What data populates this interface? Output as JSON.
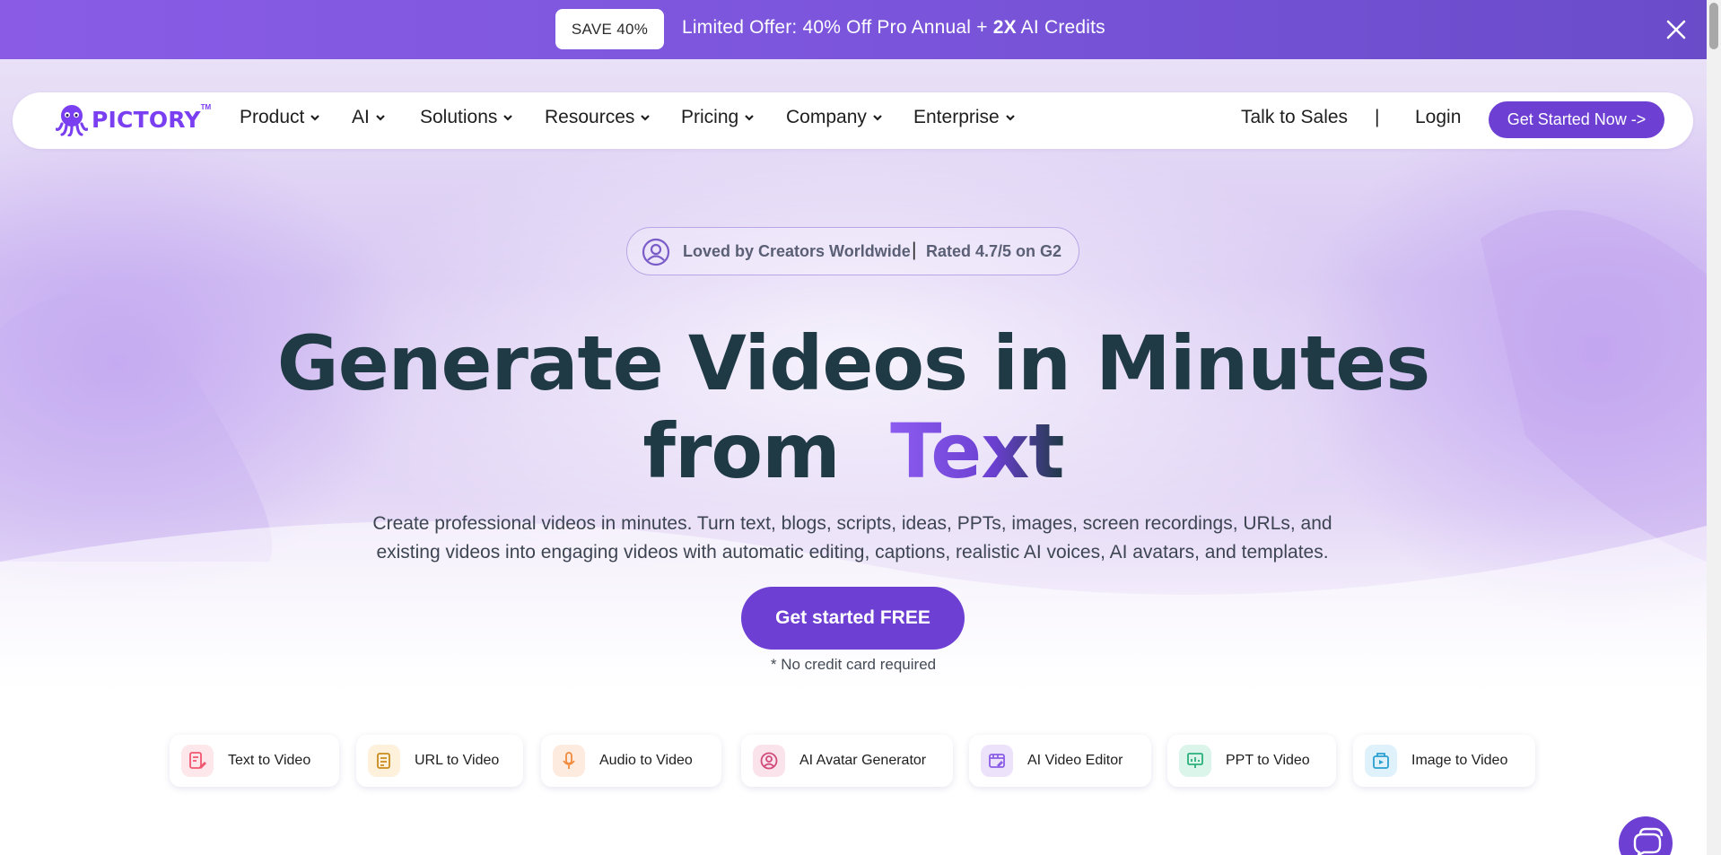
{
  "promo": {
    "badge": "SAVE 40%",
    "offer_prefix": "Limited Offer: 40% Off Pro Annual + ",
    "offer_bold": "2X",
    "offer_suffix": " AI Credits",
    "close_icon": "close-icon"
  },
  "nav": {
    "logo_text": "PICTORY",
    "logo_tm": "TM",
    "items": [
      {
        "label": "Product"
      },
      {
        "label": "AI"
      },
      {
        "label": "Solutions"
      },
      {
        "label": "Resources"
      },
      {
        "label": "Pricing"
      },
      {
        "label": "Company"
      },
      {
        "label": "Enterprise"
      }
    ],
    "talk_to_sales": "Talk to Sales",
    "divider": "|",
    "login": "Login",
    "cta": "Get Started Now ->"
  },
  "hero": {
    "loved": "Loved by Creators Worldwide",
    "loved_divider": "|",
    "rating": "Rated 4.7/5 on G2",
    "headline_line1": "Generate Videos in Minutes",
    "headline_from": "from",
    "headline_accent": "Text",
    "subtitle_line1": "Create professional videos in minutes. Turn text, blogs, scripts, ideas, PPTs, images, screen recordings, URLs, and",
    "subtitle_line2": "existing videos into engaging videos with automatic editing, captions, realistic AI voices, AI avatars, and templates.",
    "cta": "Get started FREE",
    "note": "* No credit card required"
  },
  "features": [
    {
      "label": "Text to Video",
      "icon": "text-video-icon",
      "color": "#f0566f",
      "bg": "#fde7ea"
    },
    {
      "label": "URL to Video",
      "icon": "url-video-icon",
      "color": "#c98a1b",
      "bg": "#fdf1dc"
    },
    {
      "label": "Audio to Video",
      "icon": "microphone-icon",
      "color": "#f08a3c",
      "bg": "#fdebe0"
    },
    {
      "label": "AI Avatar Generator",
      "icon": "avatar-icon",
      "color": "#d04a7a",
      "bg": "#fbe3ec"
    },
    {
      "label": "AI Video Editor",
      "icon": "video-editor-icon",
      "color": "#8a5ce6",
      "bg": "#ece3fb"
    },
    {
      "label": "PPT to Video",
      "icon": "presentation-icon",
      "color": "#2bb07a",
      "bg": "#dcf5ea"
    },
    {
      "label": "Image to Video",
      "icon": "image-video-icon",
      "color": "#2a9fd0",
      "bg": "#dff1fa"
    }
  ],
  "colors": {
    "brand": "#6d3fd3",
    "headline": "#1f3a44",
    "accent": "#8c5cf0"
  }
}
